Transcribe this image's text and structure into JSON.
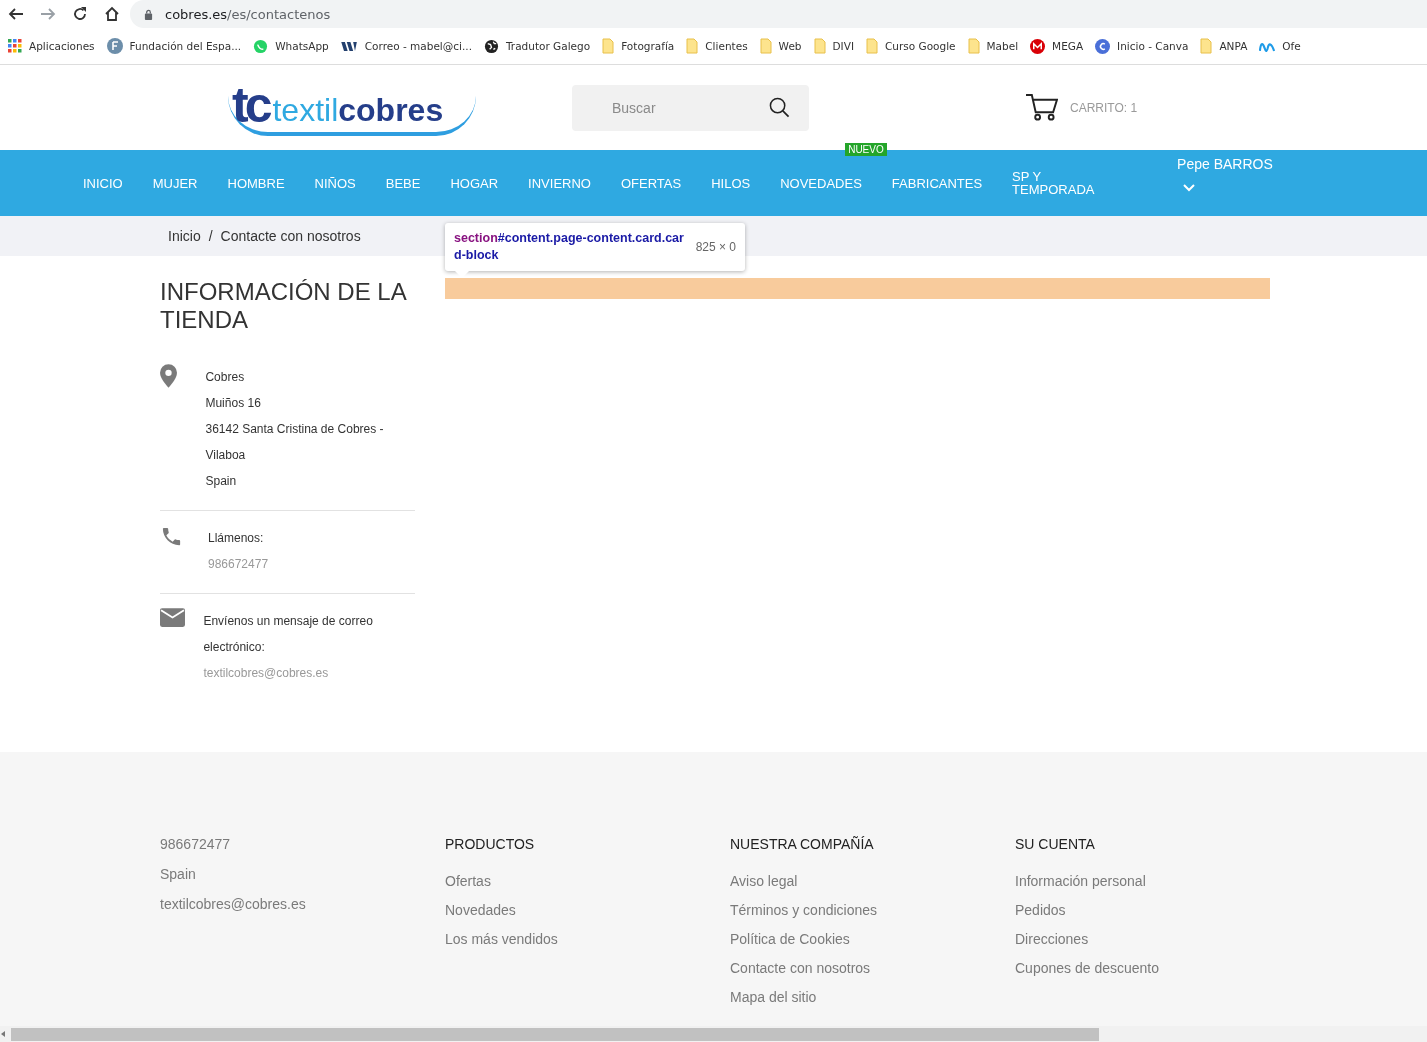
{
  "browser": {
    "back_disabled": false,
    "forward_disabled": true,
    "url_host": "cobres.es",
    "url_path": "/es/contactenos"
  },
  "bookmarks": [
    {
      "kind": "apps",
      "label": "Aplicaciones"
    },
    {
      "kind": "letter",
      "label": "Fundación del Espa..."
    },
    {
      "kind": "whatsapp",
      "label": "WhatsApp"
    },
    {
      "kind": "mail",
      "label": "Correo - mabel@ci..."
    },
    {
      "kind": "globe",
      "label": "Tradutor Galego"
    },
    {
      "kind": "folder",
      "label": "Fotografía"
    },
    {
      "kind": "folder",
      "label": "Clientes"
    },
    {
      "kind": "folder",
      "label": "Web"
    },
    {
      "kind": "folder",
      "label": "DIVI"
    },
    {
      "kind": "folder",
      "label": "Curso Google"
    },
    {
      "kind": "folder",
      "label": "Mabel"
    },
    {
      "kind": "mega",
      "label": "MEGA"
    },
    {
      "kind": "canva",
      "label": "Inicio - Canva"
    },
    {
      "kind": "folder",
      "label": "ANPA"
    },
    {
      "kind": "movistar",
      "label": "Ofe"
    }
  ],
  "header": {
    "logo_mark": "tc",
    "logo_word_1": "textil",
    "logo_word_2": "cobres",
    "search": {
      "placeholder": "Buscar"
    },
    "cart": "CARRITO: 1"
  },
  "nav": {
    "items": [
      {
        "label": "INICIO"
      },
      {
        "label": "MUJER"
      },
      {
        "label": "HOMBRE"
      },
      {
        "label": "NIÑOS"
      },
      {
        "label": "BEBE"
      },
      {
        "label": "HOGAR"
      },
      {
        "label": "INVIERNO"
      },
      {
        "label": "OFERTAS"
      },
      {
        "label": "HILOS"
      },
      {
        "label": "NOVEDADES",
        "badge": "NUEVO"
      },
      {
        "label": "FABRICANTES"
      },
      {
        "label": "SP Y TEMPORADA"
      }
    ],
    "user": "Pepe BARROS"
  },
  "breadcrumb": {
    "separator": "/",
    "items": [
      "Inicio",
      "Contacte con nosotros"
    ]
  },
  "inspector_tooltip": {
    "tag": "section",
    "selector": "#content.page-content.card.card-block",
    "size": "825 × 0"
  },
  "store_info": {
    "title": "INFORMACIÓN DE LA TIENDA",
    "blocks": [
      {
        "kind": "address",
        "lines": [
          "Cobres",
          "Muiños 16",
          "36142 Santa Cristina de Cobres - Vilaboa",
          "Spain"
        ]
      },
      {
        "kind": "phone",
        "label": "Llámenos:",
        "value": "986672477"
      },
      {
        "kind": "email",
        "label": "Envíenos un mensaje de correo electrónico:",
        "value": "textilcobres@cobres.es"
      }
    ]
  },
  "footer": {
    "contact": [
      "986672477",
      "Spain",
      "textilcobres@cobres.es"
    ],
    "columns": [
      {
        "title": "PRODUCTOS",
        "links": [
          "Ofertas",
          "Novedades",
          "Los más vendidos"
        ]
      },
      {
        "title": "NUESTRA COMPAÑÍA",
        "links": [
          "Aviso legal",
          "Términos y condiciones",
          "Política de Cookies",
          "Contacte con nosotros",
          "Mapa del sitio"
        ]
      },
      {
        "title": "SU CUENTA",
        "links": [
          "Información personal",
          "Pedidos",
          "Direcciones",
          "Cupones de descuento"
        ]
      }
    ]
  }
}
